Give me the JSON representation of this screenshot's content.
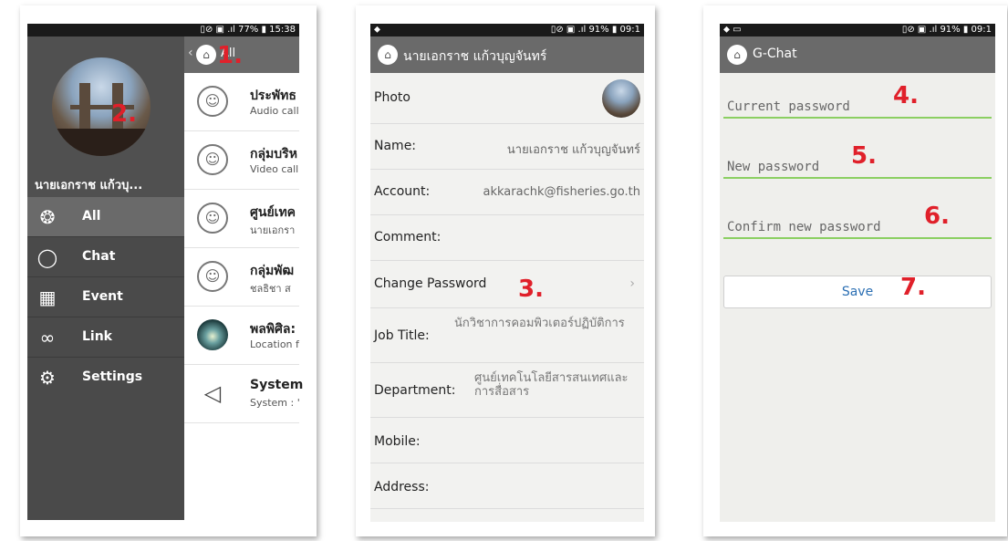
{
  "status": {
    "s1_right": "▯⊘ ▣ .ıl 77% ▮ 15:38",
    "s2_right": "▯⊘ ▣ .ıl 91% ▮ 09:1",
    "s3_right": "▯⊘ ▣ .ıl 91% ▮ 09:1"
  },
  "screen1": {
    "topbar": {
      "back": "‹",
      "title": "All"
    },
    "user_name": "นายเอกราช แก้วบุ...",
    "nav": [
      {
        "label": "All",
        "icon": "all-icon"
      },
      {
        "label": "Chat",
        "icon": "chat-bubble-icon"
      },
      {
        "label": "Event",
        "icon": "calendar-icon"
      },
      {
        "label": "Link",
        "icon": "link-icon"
      },
      {
        "label": "Settings",
        "icon": "gear-icon"
      }
    ],
    "list": [
      {
        "title": "ประพัทธ",
        "sub": "Audio call",
        "icon": "group-icon"
      },
      {
        "title": "กลุ่มบริห",
        "sub": "Video call",
        "icon": "group-icon"
      },
      {
        "title": "ศูนย์เทค",
        "sub": "นายเอกรา",
        "icon": "group-icon"
      },
      {
        "title": "กลุ่มพัฒ",
        "sub": "ชลธิชา ส",
        "icon": "group-icon"
      },
      {
        "title": "พลพิศิล:",
        "sub": "Location f",
        "icon": "photo-avatar-icon"
      },
      {
        "title": "System",
        "sub": "System : '",
        "icon": "speaker-icon"
      }
    ]
  },
  "screen2": {
    "header_title": "นายเอกราช แก้วบุญจันทร์",
    "rows": {
      "photo": "Photo",
      "name_label": "Name:",
      "name_value": "นายเอกราช แก้วบุญจันทร์",
      "account_label": "Account:",
      "account_value": "akkarachk@fisheries.go.th",
      "comment_label": "Comment:",
      "change_password": "Change Password",
      "chevron": "›",
      "job_label": "Job Title:",
      "job_value": "นักวิชาการคอมพิวเตอร์ปฏิบัติการ",
      "dept_label": "Department:",
      "dept_value": "ศูนย์เทคโนโลยีสารสนเทศและการสื่อสาร",
      "mobile_label": "Mobile:",
      "address_label": "Address:"
    }
  },
  "screen3": {
    "header_title": "G-Chat",
    "current_password_placeholder": "Current password",
    "new_password_placeholder": "New password",
    "confirm_password_placeholder": "Confirm new password",
    "save_label": "Save"
  },
  "annotations": [
    "1.",
    "2.",
    "3.",
    "4.",
    "5.",
    "6.",
    "7."
  ],
  "colors": {
    "header_gray": "#6a6a6a",
    "drawer_gray": "#4a4a4a",
    "field_underline": "#8bcf62",
    "save_text": "#2b6fb3",
    "annotation_red": "#e0202a"
  }
}
